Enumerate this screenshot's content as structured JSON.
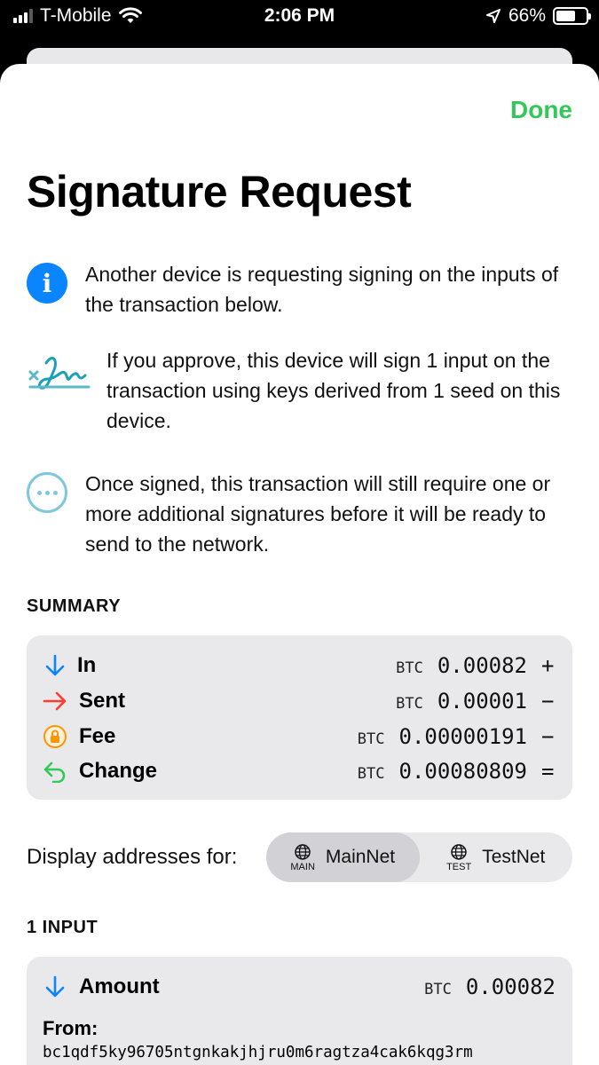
{
  "status_bar": {
    "carrier": "T-Mobile",
    "time": "2:06 PM",
    "battery": "66%",
    "battery_level": 0.66
  },
  "header": {
    "done_label": "Done",
    "title": "Signature Request"
  },
  "info": [
    {
      "icon": "info-icon",
      "text": "Another device is requesting signing on the inputs of the transaction below."
    },
    {
      "icon": "signature-icon",
      "text": "If you approve, this device will sign 1 input on the transaction using keys derived from 1 seed on this device."
    },
    {
      "icon": "ellipsis-icon",
      "text": "Once signed, this transaction will still require one or more additional signatures before it will be ready to send to the network."
    }
  ],
  "summary": {
    "label": "SUMMARY",
    "rows": [
      {
        "icon": "arrow-down-icon",
        "label": "In",
        "unit": "BTC",
        "amount": "0.00082",
        "op": "+",
        "color": "#0a84ff"
      },
      {
        "icon": "arrow-right-icon",
        "label": "Sent",
        "unit": "BTC",
        "amount": "0.00001",
        "op": "−",
        "color": "#ff3b30"
      },
      {
        "icon": "lock-icon",
        "label": "Fee",
        "unit": "BTC",
        "amount": "0.00000191",
        "op": "−",
        "color": "#ff9500"
      },
      {
        "icon": "return-arrow-icon",
        "label": "Change",
        "unit": "BTC",
        "amount": "0.00080809",
        "op": "=",
        "color": "#34c759"
      }
    ]
  },
  "display": {
    "label": "Display addresses for:",
    "options": [
      {
        "sub": "MAIN",
        "label": "MainNet",
        "selected": true
      },
      {
        "sub": "TEST",
        "label": "TestNet",
        "selected": false
      }
    ]
  },
  "inputs": {
    "label": "1 INPUT",
    "items": [
      {
        "label": "Amount",
        "unit": "BTC",
        "amount": "0.00082",
        "from_label": "From:",
        "address": "bc1qdf5ky96705ntgnkakjhjru0m6ragtza4cak6kqg3rm"
      }
    ]
  }
}
